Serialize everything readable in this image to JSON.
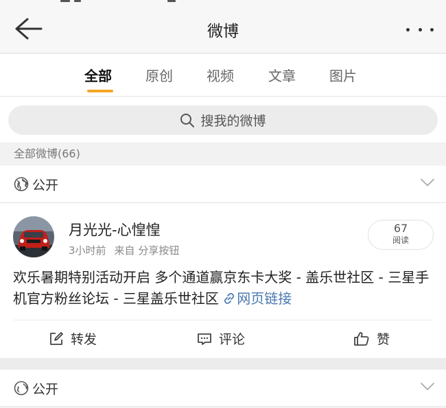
{
  "header": {
    "title": "微博"
  },
  "tabs": [
    {
      "label": "全部",
      "active": true
    },
    {
      "label": "原创",
      "active": false
    },
    {
      "label": "视频",
      "active": false
    },
    {
      "label": "文章",
      "active": false
    },
    {
      "label": "图片",
      "active": false
    }
  ],
  "search": {
    "placeholder": "搜我的微博"
  },
  "summary": {
    "label": "全部微博(66)"
  },
  "visibility": {
    "label": "公开"
  },
  "post": {
    "author": "月光光-心惶惶",
    "time": "3小时前",
    "source": "来自 分享按钮",
    "reads_count": "67",
    "reads_label": "阅读",
    "text": "欢乐暑期特别活动开启 多个通道赢京东卡大奖 - 盖乐世社区 - 三星手机官方粉丝论坛 - 三星盖乐世社区 ",
    "link_label": "网页链接",
    "actions": {
      "repost": "转发",
      "comment": "评论",
      "like": "赞"
    }
  },
  "next_visibility": {
    "label": "公开"
  },
  "colors": {
    "accent": "#f6a623",
    "link": "#4a78b0"
  },
  "icons": [
    "back-arrow-icon",
    "more-dots-icon",
    "search-icon",
    "globe-icon",
    "chevron-down-icon",
    "link-icon",
    "edit-icon",
    "comment-icon",
    "thumbs-up-icon"
  ]
}
